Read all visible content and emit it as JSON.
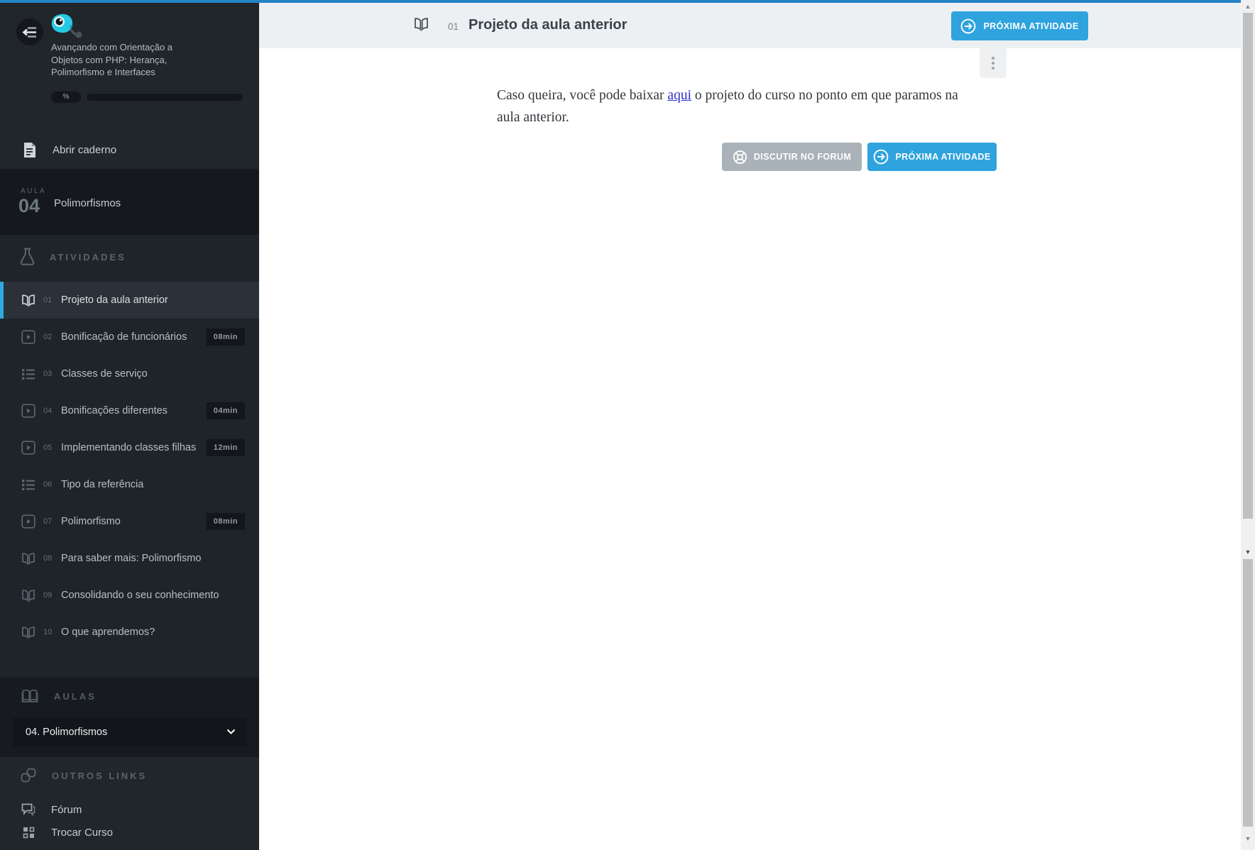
{
  "sidebar": {
    "course_title_lines": {
      "l1": "Avançando com Orientação a",
      "l2": "Objetos com PHP: Herança,",
      "l3": "Polimorfismo e Interfaces"
    },
    "progress_label": "%",
    "open_notebook_label": "Abrir caderno",
    "lesson_badge": {
      "kicker": "AULA",
      "number": "04",
      "title": "Polimorfismos"
    },
    "sections": {
      "activities_label": "ATIVIDADES",
      "lessons_label": "AULAS",
      "other_links_label": "OUTROS LINKS"
    },
    "activities": [
      {
        "num": "01",
        "label": "Projeto da aula anterior",
        "type": "reading",
        "duration": "",
        "active": true
      },
      {
        "num": "02",
        "label": "Bonificação de funcionários",
        "type": "video",
        "duration": "08min"
      },
      {
        "num": "03",
        "label": "Classes de serviço",
        "type": "exercise",
        "duration": ""
      },
      {
        "num": "04",
        "label": "Bonificações diferentes",
        "type": "video",
        "duration": "04min"
      },
      {
        "num": "05",
        "label": "Implementando classes filhas",
        "type": "video",
        "duration": "12min"
      },
      {
        "num": "06",
        "label": "Tipo da referência",
        "type": "exercise",
        "duration": ""
      },
      {
        "num": "07",
        "label": "Polimorfismo",
        "type": "video",
        "duration": "08min"
      },
      {
        "num": "08",
        "label": "Para saber mais: Polimorfismo",
        "type": "reading",
        "duration": ""
      },
      {
        "num": "09",
        "label": "Consolidando o seu conhecimento",
        "type": "reading",
        "duration": ""
      },
      {
        "num": "10",
        "label": "O que aprendemos?",
        "type": "reading",
        "duration": ""
      }
    ],
    "lesson_select_value": "04. Polimorfismos",
    "other_links": [
      {
        "label": "Fórum"
      },
      {
        "label": "Trocar Curso"
      }
    ]
  },
  "header": {
    "activity_number": "01",
    "title": "Projeto da aula anterior",
    "next_button_label": "PRÓXIMA ATIVIDADE"
  },
  "content": {
    "para_before_link": "Caso queira, você pode baixar ",
    "link_text": "aqui",
    "para_after_link": " o projeto do curso no ponto em que paramos na aula anterior.",
    "forum_button_label": "DISCUTIR NO FORUM",
    "next_button_label": "PRÓXIMA ATIVIDADE"
  },
  "colors": {
    "accent_blue": "#2fa3dd",
    "active_item_bar": "#2fa9e1",
    "top_line": "#2583c6",
    "link_blue": "#2b30c4",
    "sidebar_bg": "#21262b"
  }
}
